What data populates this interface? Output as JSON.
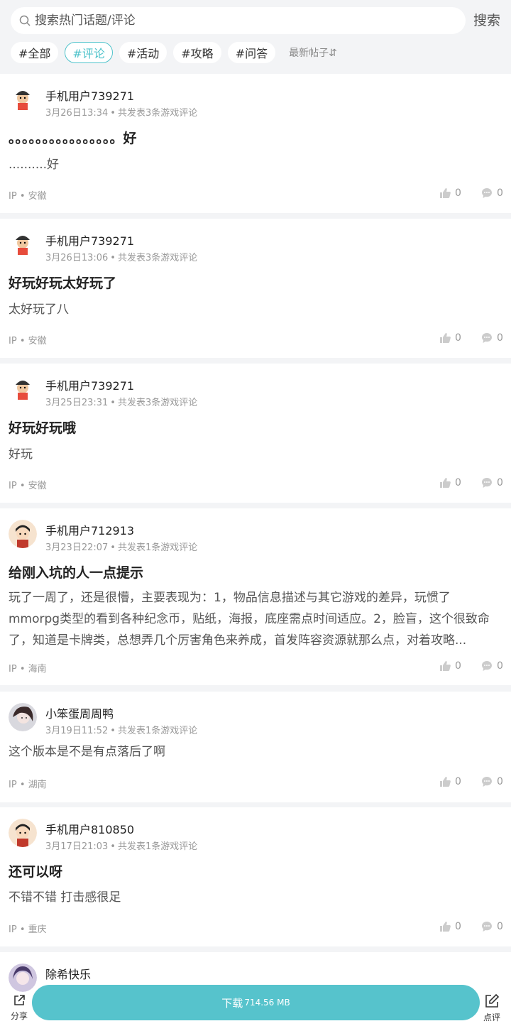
{
  "search": {
    "placeholder": "搜索热门话题/评论",
    "button": "搜索"
  },
  "tags": [
    "#全部",
    "#评论",
    "#活动",
    "#攻略",
    "#问答"
  ],
  "active_tag": "#评论",
  "sort_label": "最新帖子⇵",
  "posts": [
    {
      "user": "手机用户739271",
      "date": "3月26日13:34",
      "stat": "共发表3条游戏评论",
      "title": "。。。。。。。。。。。。。。。。好",
      "body": "..........好",
      "ip": "IP",
      "region": "安徽",
      "likes": "0",
      "comments": "0"
    },
    {
      "user": "手机用户739271",
      "date": "3月26日13:06",
      "stat": "共发表3条游戏评论",
      "title": "好玩好玩太好玩了",
      "body": "太好玩了八",
      "ip": "IP",
      "region": "安徽",
      "likes": "0",
      "comments": "0"
    },
    {
      "user": "手机用户739271",
      "date": "3月25日23:31",
      "stat": "共发表3条游戏评论",
      "title": "好玩好玩哦",
      "body": "好玩",
      "ip": "IP",
      "region": "安徽",
      "likes": "0",
      "comments": "0"
    },
    {
      "user": "手机用户712913",
      "date": "3月23日22:07",
      "stat": "共发表1条游戏评论",
      "title": "给刚入坑的人一点提示",
      "body": "玩了一周了，还是很懵，主要表现为：1，物品信息描述与其它游戏的差异，玩惯了mmorpg类型的看到各种纪念币，贴纸，海报，底座需点时间适应。2，脸盲，这个很致命了，知道是卡牌类，总想弄几个厉害角色来养成，首发阵容资源就那么点，对着攻略...",
      "ip": "IP",
      "region": "海南",
      "likes": "0",
      "comments": "0"
    },
    {
      "user": "小笨蛋周周鸭",
      "date": "3月19日11:52",
      "stat": "共发表1条游戏评论",
      "title": "",
      "body": "这个版本是不是有点落后了啊",
      "ip": "IP",
      "region": "湖南",
      "likes": "0",
      "comments": "0"
    },
    {
      "user": "手机用户810850",
      "date": "3月17日21:03",
      "stat": "共发表1条游戏评论",
      "title": "还可以呀",
      "body": "不错不错 打击感很足",
      "ip": "IP",
      "region": "重庆",
      "likes": "0",
      "comments": "0"
    },
    {
      "user": "除希快乐"
    }
  ],
  "bottom": {
    "share": "分享",
    "download": "下载",
    "size": "714.56 MB",
    "review": "点评"
  }
}
